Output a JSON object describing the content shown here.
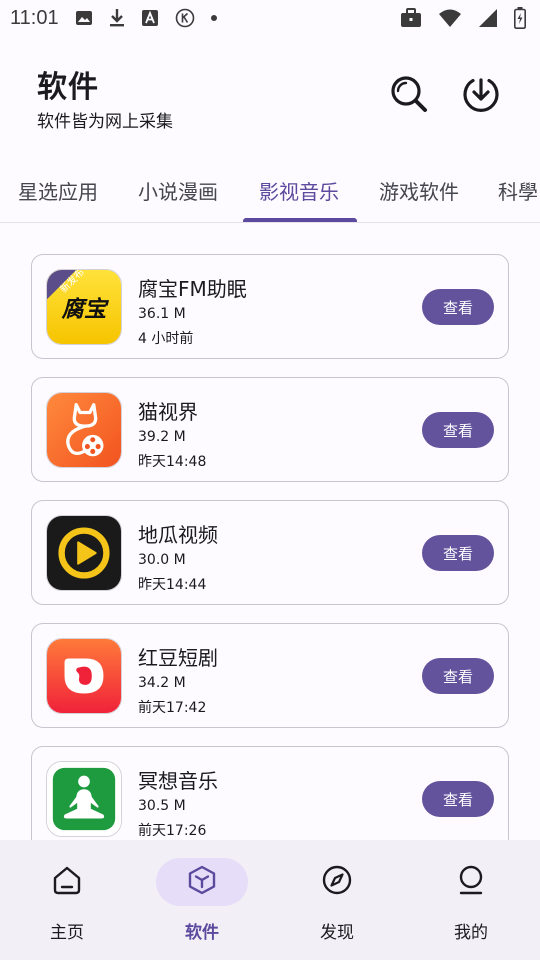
{
  "status_bar": {
    "time": "11:01",
    "icons_left": [
      "image-icon",
      "download-icon",
      "font-icon",
      "k-circle-icon",
      "dot-icon"
    ],
    "icons_right": [
      "briefcase-icon",
      "wifi-icon",
      "signal-icon",
      "battery-icon"
    ]
  },
  "header": {
    "title": "软件",
    "subtitle": "软件皆为网上采集",
    "search_icon": "search-icon",
    "download_icon": "download-circle-icon"
  },
  "tabs": [
    {
      "label": "星选应用",
      "active": false
    },
    {
      "label": "小说漫画",
      "active": false
    },
    {
      "label": "影视音乐",
      "active": true
    },
    {
      "label": "游戏软件",
      "active": false
    },
    {
      "label": "科學",
      "active": false
    }
  ],
  "apps": [
    {
      "name": "腐宝FM助眠",
      "size": "36.1 M",
      "time": "4 小时前",
      "button": "查看",
      "icon": "fubao-icon",
      "icon_text": "腐宝",
      "badge": "新发布"
    },
    {
      "name": "猫视界",
      "size": "39.2 M",
      "time": "昨天14:48",
      "button": "查看",
      "icon": "cat-film-icon"
    },
    {
      "name": "地瓜视频",
      "size": "30.0 M",
      "time": "昨天14:44",
      "button": "查看",
      "icon": "play-circle-icon"
    },
    {
      "name": "红豆短剧",
      "size": "34.2 M",
      "time": "前天17:42",
      "button": "查看",
      "icon": "red-bean-icon"
    },
    {
      "name": "冥想音乐",
      "size": "30.5 M",
      "time": "前天17:26",
      "button": "查看",
      "icon": "meditation-icon"
    }
  ],
  "bottom_nav": [
    {
      "label": "主页",
      "icon": "home-icon",
      "active": false
    },
    {
      "label": "软件",
      "icon": "cube-icon",
      "active": true
    },
    {
      "label": "发现",
      "icon": "compass-icon",
      "active": false
    },
    {
      "label": "我的",
      "icon": "profile-icon",
      "active": false
    }
  ],
  "colors": {
    "accent": "#63539d",
    "active_tab": "#5b4a9e",
    "nav_background": "#f2eff6",
    "nav_active_pill": "#e6def8"
  }
}
